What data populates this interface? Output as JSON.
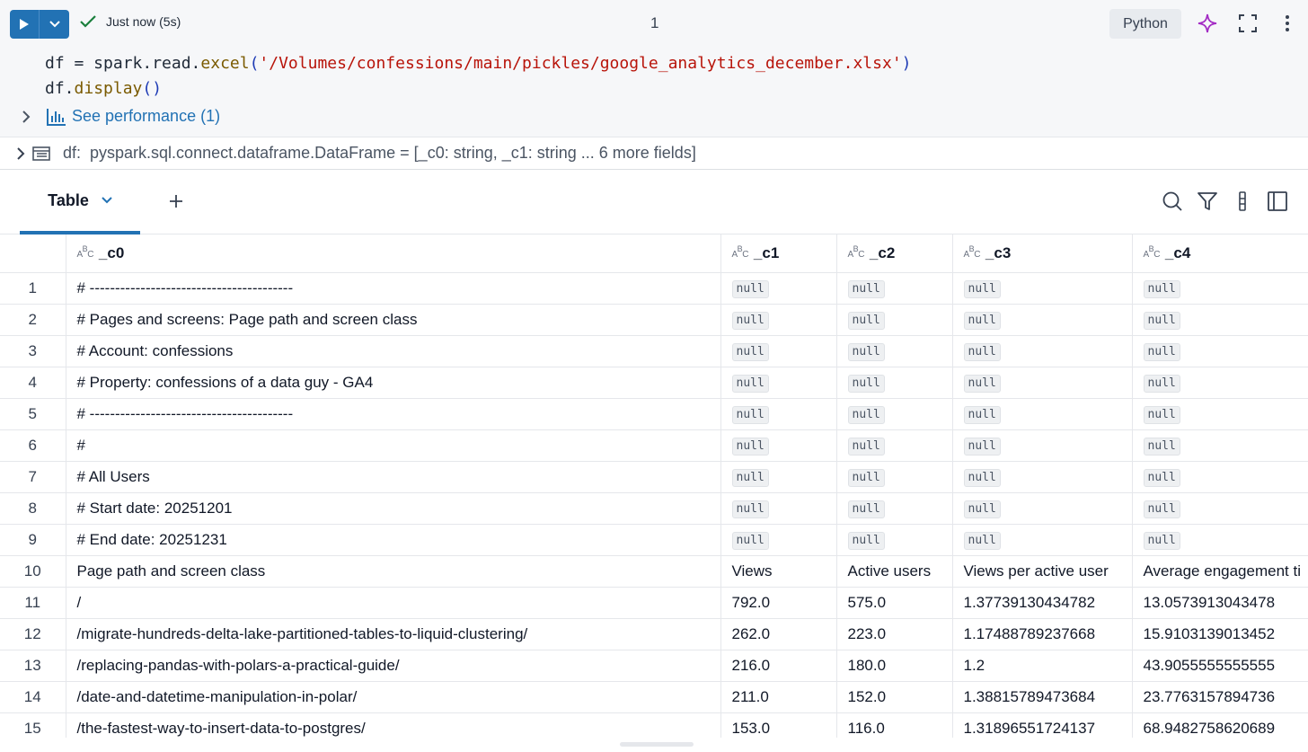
{
  "toolbar": {
    "status_text": "Just now (5s)",
    "cell_number": "1",
    "language": "Python"
  },
  "code": {
    "line1": {
      "prefix": "df = spark.read.",
      "fn": "excel",
      "open": "(",
      "str": "'/Volumes/confessions/main/pickles/google_analytics_december.xlsx'",
      "close": ")"
    },
    "line2": {
      "prefix": "df.",
      "fn": "display",
      "parens": "()"
    }
  },
  "performance_link": "See performance (1)",
  "schema": {
    "var": "df:",
    "type": "pyspark.sql.connect.dataframe.DataFrame = [_c0: string, _c1: string ... 6 more fields]"
  },
  "results": {
    "tab_label": "Table"
  },
  "table": {
    "type_marker": {
      "a": "A",
      "b": "B",
      "c": "C"
    },
    "columns": [
      "_c0",
      "_c1",
      "_c2",
      "_c3",
      "_c4"
    ],
    "null_label": "null",
    "rows": [
      {
        "idx": "1",
        "cells": [
          "# ----------------------------------------",
          null,
          null,
          null,
          null
        ]
      },
      {
        "idx": "2",
        "cells": [
          "# Pages and screens: Page path and screen class",
          null,
          null,
          null,
          null
        ]
      },
      {
        "idx": "3",
        "cells": [
          "# Account: confessions",
          null,
          null,
          null,
          null
        ]
      },
      {
        "idx": "4",
        "cells": [
          "# Property: confessions of a data guy - GA4",
          null,
          null,
          null,
          null
        ]
      },
      {
        "idx": "5",
        "cells": [
          "# ----------------------------------------",
          null,
          null,
          null,
          null
        ]
      },
      {
        "idx": "6",
        "cells": [
          "#",
          null,
          null,
          null,
          null
        ]
      },
      {
        "idx": "7",
        "cells": [
          "# All Users",
          null,
          null,
          null,
          null
        ]
      },
      {
        "idx": "8",
        "cells": [
          "# Start date: 20251201",
          null,
          null,
          null,
          null
        ]
      },
      {
        "idx": "9",
        "cells": [
          "# End date: 20251231",
          null,
          null,
          null,
          null
        ]
      },
      {
        "idx": "10",
        "cells": [
          "Page path and screen class",
          "Views",
          "Active users",
          "Views per active user",
          "Average engagement ti"
        ]
      },
      {
        "idx": "11",
        "cells": [
          "/",
          "792.0",
          "575.0",
          "1.37739130434782",
          "13.0573913043478"
        ]
      },
      {
        "idx": "12",
        "cells": [
          "/migrate-hundreds-delta-lake-partitioned-tables-to-liquid-clustering/",
          "262.0",
          "223.0",
          "1.17488789237668",
          "15.9103139013452"
        ]
      },
      {
        "idx": "13",
        "cells": [
          "/replacing-pandas-with-polars-a-practical-guide/",
          "216.0",
          "180.0",
          "1.2",
          "43.9055555555555"
        ]
      },
      {
        "idx": "14",
        "cells": [
          "/date-and-datetime-manipulation-in-polar/",
          "211.0",
          "152.0",
          "1.38815789473684",
          "23.7763157894736"
        ]
      },
      {
        "idx": "15",
        "cells": [
          "/the-fastest-way-to-insert-data-to-postgres/",
          "153.0",
          "116.0",
          "1.31896551724137",
          "68.9482758620689"
        ]
      }
    ]
  }
}
